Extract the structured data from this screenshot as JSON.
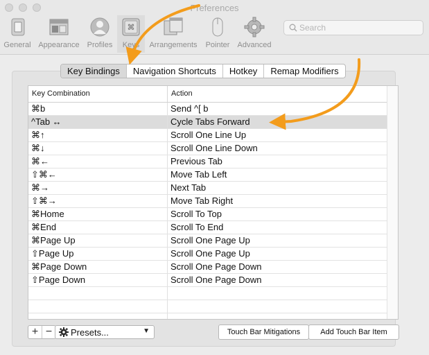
{
  "window": {
    "title": "Preferences"
  },
  "toolbar": {
    "items": [
      {
        "label": "General",
        "icon": "general-icon"
      },
      {
        "label": "Appearance",
        "icon": "appearance-icon"
      },
      {
        "label": "Profiles",
        "icon": "profiles-icon"
      },
      {
        "label": "Keys",
        "icon": "keys-icon",
        "selected": true
      },
      {
        "label": "Arrangements",
        "icon": "arrangements-icon"
      },
      {
        "label": "Pointer",
        "icon": "pointer-icon"
      },
      {
        "label": "Advanced",
        "icon": "advanced-icon"
      }
    ],
    "search": {
      "placeholder": "Search",
      "value": ""
    }
  },
  "tabs": [
    {
      "label": "Key Bindings",
      "active": true
    },
    {
      "label": "Navigation Shortcuts"
    },
    {
      "label": "Hotkey"
    },
    {
      "label": "Remap Modifiers"
    }
  ],
  "table": {
    "columns": [
      "Key Combination",
      "Action"
    ],
    "selected_row": 1,
    "rows": [
      {
        "key": "⌘b",
        "action": "Send ^[ b"
      },
      {
        "key": "^Tab ↔",
        "action": "Cycle Tabs Forward"
      },
      {
        "key": "⌘↑",
        "action": "Scroll One Line Up"
      },
      {
        "key": "⌘↓",
        "action": "Scroll One Line Down"
      },
      {
        "key": "⌘←",
        "action": "Previous Tab"
      },
      {
        "key": "⇧⌘←",
        "action": "Move Tab Left"
      },
      {
        "key": "⌘→",
        "action": "Next Tab"
      },
      {
        "key": "⇧⌘→",
        "action": "Move Tab Right"
      },
      {
        "key": "⌘Home",
        "action": "Scroll To Top"
      },
      {
        "key": "⌘End",
        "action": "Scroll To End"
      },
      {
        "key": "⌘Page Up",
        "action": "Scroll One Page Up"
      },
      {
        "key": "⇧Page Up",
        "action": "Scroll One Page Up"
      },
      {
        "key": "⌘Page Down",
        "action": "Scroll One Page Down"
      },
      {
        "key": "⇧Page Down",
        "action": "Scroll One Page Down"
      }
    ]
  },
  "bottom": {
    "add_label": "+",
    "remove_label": "−",
    "presets_label": "Presets...",
    "touch_bar_mitigations_label": "Touch Bar Mitigations",
    "add_touch_bar_item_label": "Add Touch Bar Item"
  },
  "annotation": {
    "arrow_color": "#f39c1c"
  }
}
